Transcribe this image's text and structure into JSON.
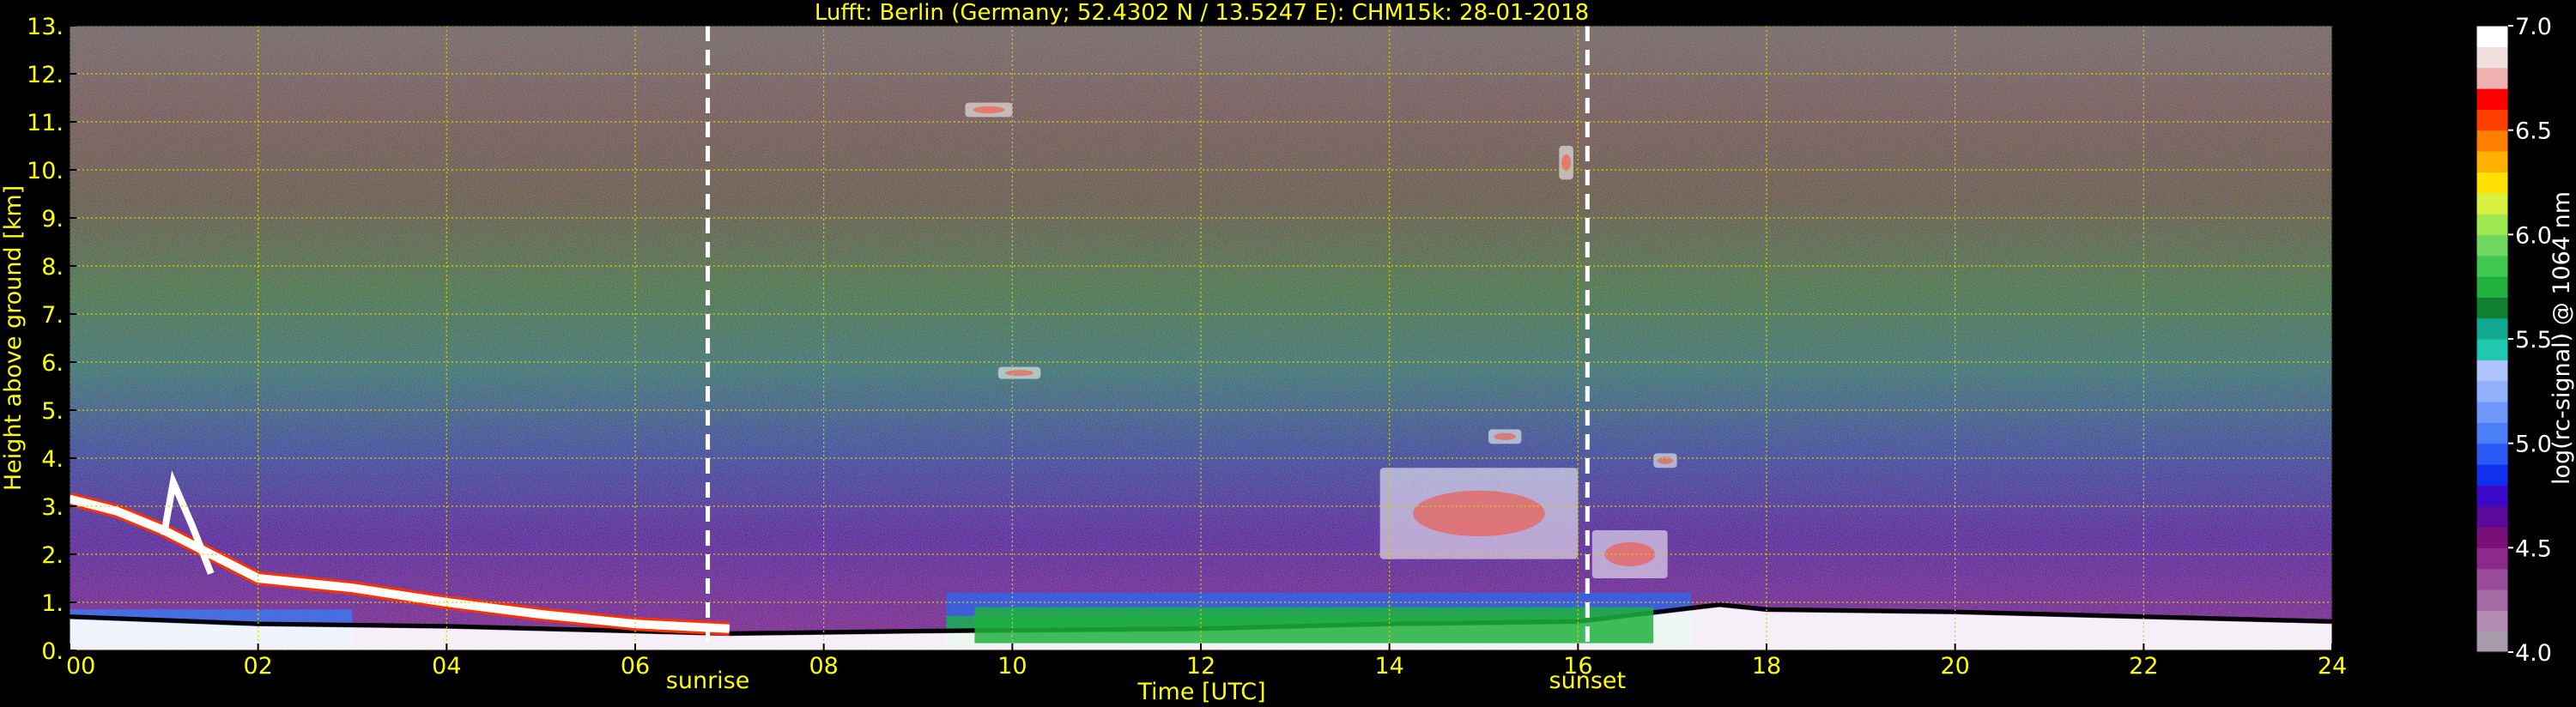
{
  "chart_data": {
    "type": "heatmap",
    "title": "Lufft: Berlin (Germany; 52.4302 N / 13.5247 E):    CHM15k: 28-01-2018",
    "xlabel": "Time [UTC]",
    "ylabel": "Height above ground [km]",
    "x_ticks": [
      "00",
      "02",
      "04",
      "06",
      "08",
      "10",
      "12",
      "14",
      "16",
      "18",
      "20",
      "22",
      "24"
    ],
    "y_ticks": [
      "0.",
      "1.",
      "2.",
      "3.",
      "4.",
      "5.",
      "6.",
      "7.",
      "8.",
      "9.",
      "10.",
      "11.",
      "12.",
      "13."
    ],
    "xlim": [
      0,
      24
    ],
    "ylim": [
      0,
      13
    ],
    "grid": true,
    "colorbar": {
      "label": "log(rc-signal) @ 1064 nm",
      "ticks": [
        "4.0",
        "4.5",
        "5.0",
        "5.5",
        "6.0",
        "6.5",
        "7.0"
      ],
      "range": [
        4.0,
        7.0
      ],
      "colors": [
        "#a89aa8",
        "#b28cb2",
        "#a36aa3",
        "#9a4d9a",
        "#8a2a8a",
        "#7a0f7a",
        "#5a0a9a",
        "#3a0ac8",
        "#1030f0",
        "#2a5af5",
        "#4a7ff8",
        "#6f98fa",
        "#90b0fc",
        "#aec4ff",
        "#20c8b0",
        "#10a890",
        "#108030",
        "#20b040",
        "#40c850",
        "#70d860",
        "#a0e850",
        "#d8f040",
        "#ffe000",
        "#ffb000",
        "#ff8000",
        "#ff4000",
        "#ff0000",
        "#f0b0b0",
        "#f0e0e0",
        "#ffffff"
      ]
    },
    "markers": [
      {
        "label": "sunrise",
        "time": 6.77
      },
      {
        "label": "sunset",
        "time": 16.1
      }
    ],
    "features": {
      "boundary_layer_top_km": [
        [
          0,
          0.65
        ],
        [
          2,
          0.5
        ],
        [
          4,
          0.45
        ],
        [
          6,
          0.35
        ],
        [
          7,
          0.3
        ],
        [
          9,
          0.35
        ],
        [
          12,
          0.4
        ],
        [
          14,
          0.5
        ],
        [
          16,
          0.55
        ],
        [
          17.5,
          0.9
        ],
        [
          18,
          0.8
        ],
        [
          20,
          0.75
        ],
        [
          22,
          0.65
        ],
        [
          24,
          0.55
        ]
      ],
      "residual_layer_km": [
        [
          0,
          3.15
        ],
        [
          0.5,
          2.9
        ],
        [
          1,
          2.5
        ],
        [
          1.5,
          2.0
        ],
        [
          2,
          1.5
        ],
        [
          3,
          1.3
        ],
        [
          4,
          1.0
        ],
        [
          5,
          0.75
        ],
        [
          6,
          0.55
        ],
        [
          7,
          0.45
        ]
      ],
      "clouds": [
        {
          "t0": 13.9,
          "t1": 16.0,
          "h0": 1.9,
          "h1": 3.8
        },
        {
          "t0": 16.15,
          "t1": 16.95,
          "h0": 1.5,
          "h1": 2.5
        },
        {
          "t0": 16.8,
          "t1": 17.05,
          "h0": 3.8,
          "h1": 4.1
        },
        {
          "t0": 15.05,
          "t1": 15.4,
          "h0": 4.3,
          "h1": 4.6
        },
        {
          "t0": 9.85,
          "t1": 10.3,
          "h0": 5.65,
          "h1": 5.9
        },
        {
          "t0": 15.8,
          "t1": 15.95,
          "h0": 9.8,
          "h1": 10.5
        },
        {
          "t0": 9.5,
          "t1": 10.0,
          "h0": 11.1,
          "h1": 11.4
        }
      ],
      "aerosol_band": [
        {
          "t0": 9.3,
          "t1": 17.2,
          "h0": 0.1,
          "h1": 1.2
        }
      ]
    }
  }
}
